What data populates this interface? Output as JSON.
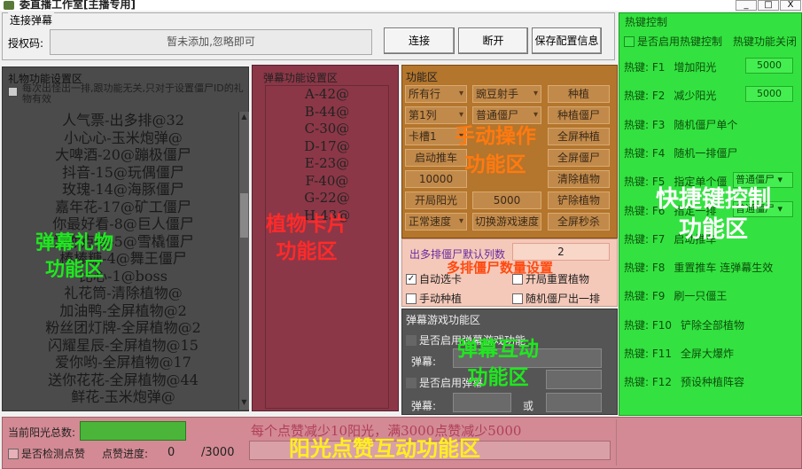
{
  "window": {
    "title": "委直播工作室[主播专用]",
    "minimize": "_",
    "maximize": "□",
    "close": "X"
  },
  "connect": {
    "caption": "连接弹幕",
    "auth_label": "授权码:",
    "auth_placeholder": "暂未添加,忽略即可",
    "connect_btn": "连接",
    "disconnect_btn": "断开",
    "save_btn": "保存配置信息"
  },
  "gift": {
    "caption": "礼物功能设置区",
    "option": "每次出怪出一排,跟功能无关,只对于设置僵尸ID的礼物有效",
    "items": [
      "人气票-出多排@32",
      "小心心-玉米炮弹@",
      "大啤酒-20@蹦极僵尸",
      "抖音-15@玩偶僵尸",
      "玫瑰-14@海豚僵尸",
      "嘉年花-17@矿工僵尸",
      "你最好看-8@巨人僵尸",
      "为你点亮-5@雪橇僵尸",
      "棒棒糖-4@舞王僵尸",
      "比心-1@boss",
      "礼花筒-清除植物@",
      "加油鸭-全屏植物@2",
      "粉丝团灯牌-全屏植物@2",
      "闪耀星辰-全屏植物@15",
      "爱你哟-全屏植物@17",
      "送你花花-全屏植物@44",
      "鲜花-玉米炮弹@"
    ],
    "overlay": "弹幕礼物\n功能区"
  },
  "barrage": {
    "caption": "弹幕功能设置区",
    "items": [
      "A-42@",
      "B-44@",
      "C-30@",
      "D-17@",
      "E-23@",
      "F-40@",
      "G-22@",
      "H-43@"
    ],
    "overlay": "植物卡片\n功能区"
  },
  "func": {
    "caption": "功能区",
    "rows": [
      [
        "所有行",
        "豌豆射手",
        "种植"
      ],
      [
        "第1列",
        "普通僵尸",
        "种植僵尸"
      ],
      [
        "卡槽1",
        "",
        "全屏种植"
      ],
      [
        "启动推车",
        "",
        "全屏僵尸"
      ],
      [
        "10000",
        "",
        "清除植物"
      ],
      [
        "开局阳光",
        "5000",
        "铲除植物"
      ],
      [
        "正常速度",
        "切换游戏速度",
        "全屏秒杀"
      ]
    ],
    "overlay": "手动操作\n功能区"
  },
  "multirow": {
    "label": "出多排僵尸默认列数",
    "value": "2",
    "overlay": "多排僵尸数量设置",
    "auto_card": "自动选卡",
    "auto_card_checked": true,
    "reset_plants": "开局重置植物",
    "manual_plant": "手动种植",
    "random_zombie": "随机僵尸出一排"
  },
  "interact": {
    "caption": "弹幕游戏功能区",
    "enable1": "是否启用弹幕游戏功能",
    "enable2": "是否启用弹幕",
    "barrage_label": "弹幕:",
    "or_label": "或",
    "overlay": "弹幕互动\n功能区"
  },
  "hotkey": {
    "caption": "热键控制",
    "enable": "是否启用热键控制",
    "status": "热键功能关闭",
    "rows": [
      {
        "key": "热键: F1",
        "label": "增加阳光",
        "value": "5000"
      },
      {
        "key": "热键: F2",
        "label": "减少阳光",
        "value": "5000"
      },
      {
        "key": "热键: F3",
        "label": "随机僵尸单个"
      },
      {
        "key": "热键: F4",
        "label": "随机一排僵尸"
      },
      {
        "key": "热键: F5",
        "label": "指定单个僵",
        "select": "普通僵尸"
      },
      {
        "key": "热键: F6",
        "label": "指定一排",
        "select": "普通僵尸"
      },
      {
        "key": "热键: F7",
        "label": "启动推车"
      },
      {
        "key": "热键: F8",
        "label": "重置推车 连弹幕生效"
      },
      {
        "key": "热键: F9",
        "label": "刷一只僵王"
      },
      {
        "key": "热键: F10",
        "label": "铲除全部植物"
      },
      {
        "key": "热键: F11",
        "label": "全屏大爆炸"
      },
      {
        "key": "热键: F12",
        "label": "预设种植阵容"
      }
    ],
    "overlay": "快捷键控制\n功能区"
  },
  "sun": {
    "total_label": "当前阳光总数:",
    "detect_label": "是否检测点赞",
    "progress_label": "点赞进度:",
    "progress_value": "0",
    "progress_max": "/3000",
    "banner": "每个点赞减少10阳光，满3000点赞减少5000",
    "overlay": "阳光点赞互动功能区"
  },
  "colors": {
    "gift_bg": "#4b4b4b",
    "barrage_bg": "#8b3747",
    "func_bg": "#b4752c",
    "hot_bg": "#33e240",
    "sun_bg": "#d38a94"
  }
}
